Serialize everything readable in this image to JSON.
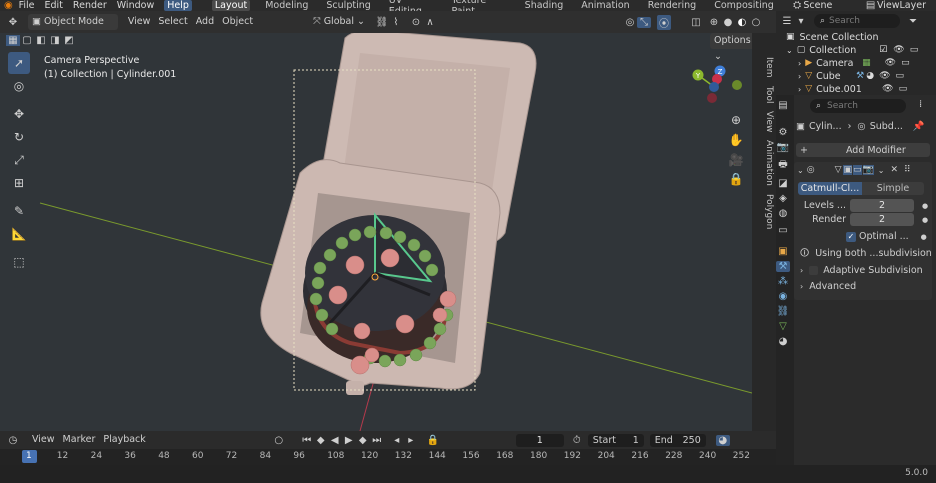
{
  "topbar": {
    "menus": [
      "File",
      "Edit",
      "Render",
      "Window",
      "Help"
    ],
    "workspaces": [
      "Layout",
      "Modeling",
      "Sculpting",
      "UV Editing",
      "Texture Paint",
      "Shading",
      "Animation",
      "Rendering",
      "Compositing"
    ],
    "active_workspace": "Layout",
    "scene": "Scene",
    "view_layer": "ViewLayer"
  },
  "viewport_header": {
    "mode": "Object Mode",
    "menus": [
      "View",
      "Select",
      "Add",
      "Object"
    ],
    "transform_orientation": "Global",
    "options_label": "Options"
  },
  "viewport": {
    "camera_label": "Camera Perspective",
    "collection_label": "(1) Collection | Cylinder.001",
    "side_tabs": [
      "Item",
      "Tool",
      "View",
      "Animation",
      "Polygon"
    ]
  },
  "outliner": {
    "search_placeholder": "Search",
    "scene_collection": "Scene Collection",
    "items": [
      {
        "name": "Collection",
        "type": "collection"
      },
      {
        "name": "Camera",
        "type": "camera"
      },
      {
        "name": "Cube",
        "type": "mesh"
      },
      {
        "name": "Cube.001",
        "type": "mesh"
      }
    ]
  },
  "properties": {
    "search_placeholder": "Search",
    "breadcrumb_object": "Cylin...",
    "breadcrumb_modifier": "Subd...",
    "add_modifier": "Add Modifier",
    "subdiv_modes": [
      "Catmull-Cl...",
      "Simple"
    ],
    "active_mode": "Catmull-Cl...",
    "levels_label": "Levels ...",
    "levels_value": "2",
    "render_label": "Render",
    "render_value": "2",
    "optimal_label": "Optimal ...",
    "optimal_checked": true,
    "info_text": "Using both ...subdivision",
    "adaptive_label": "Adaptive Subdivision",
    "advanced_label": "Advanced"
  },
  "timeline": {
    "menus": [
      "View",
      "Marker",
      "Playback"
    ],
    "current_frame": "1",
    "start_label": "Start",
    "start_value": "1",
    "end_label": "End",
    "end_value": "250",
    "ruler_ticks": [
      "1",
      "12",
      "24",
      "36",
      "48",
      "60",
      "72",
      "84",
      "96",
      "108",
      "120",
      "132",
      "144",
      "156",
      "168",
      "180",
      "192",
      "204",
      "216",
      "228",
      "240",
      "252"
    ]
  },
  "status": {
    "version": "5.0.0"
  },
  "colors": {
    "accent": "#3d5a80",
    "axis_x": "#d9465a",
    "axis_y": "#8cc53f",
    "axis_z": "#3f7fd9",
    "gizmo_y": "#8cb82d",
    "gizmo_z": "#3f7fd9",
    "gizmo_x": "#c8304a"
  }
}
